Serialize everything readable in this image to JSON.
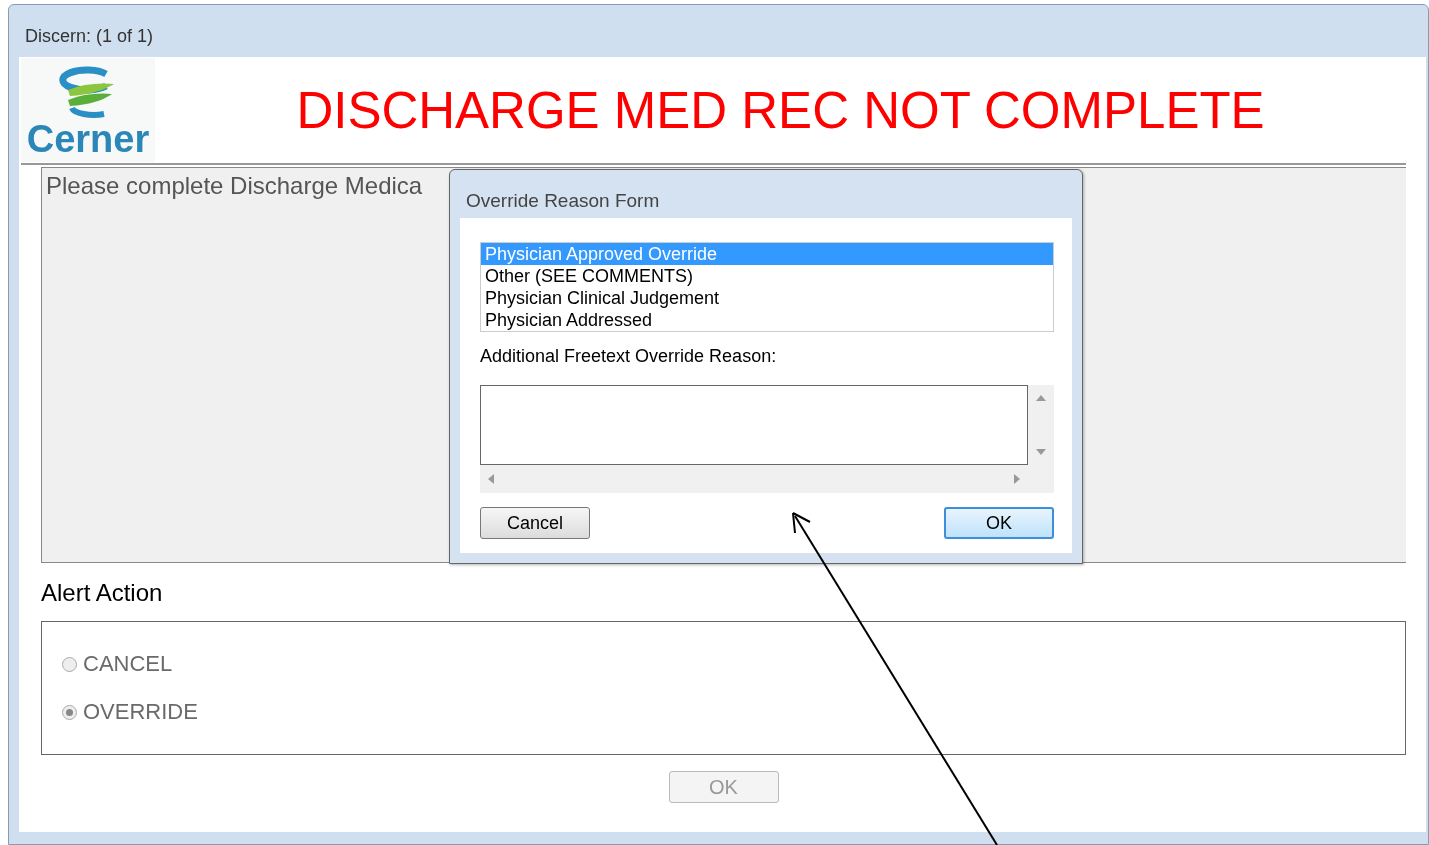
{
  "window": {
    "title": "Discern:  (1 of 1)"
  },
  "header": {
    "logo_text": "Cerner",
    "alert_title": "DISCHARGE MED REC NOT COMPLETE"
  },
  "message": {
    "text": "Please complete Discharge Medica"
  },
  "alert_action": {
    "label": "Alert Action",
    "options": [
      {
        "label": "CANCEL",
        "selected": false,
        "disabled": true
      },
      {
        "label": "OVERRIDE",
        "selected": true,
        "disabled": true
      }
    ]
  },
  "ok_button": {
    "label": "OK",
    "disabled": true
  },
  "override_dialog": {
    "title": "Override Reason Form",
    "reasons": [
      {
        "label": "Physician Approved Override",
        "selected": true
      },
      {
        "label": "Other (SEE COMMENTS)",
        "selected": false
      },
      {
        "label": "Physician Clinical Judgement",
        "selected": false
      },
      {
        "label": "Physician Addressed",
        "selected": false
      }
    ],
    "freetext_label": "Additional Freetext Override Reason:",
    "buttons": [
      {
        "label": "Cancel",
        "kind": "normal"
      },
      {
        "label": "OK",
        "kind": "default"
      }
    ]
  }
}
